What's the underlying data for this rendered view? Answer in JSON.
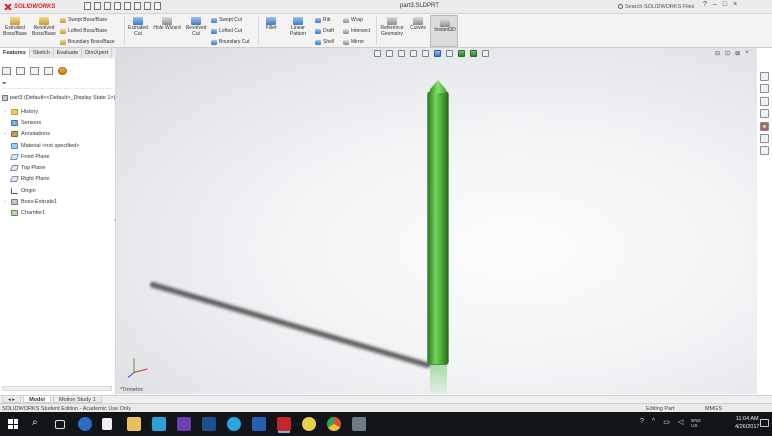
{
  "app": {
    "brand": "SOLIDWORKS",
    "document_title": "part3.SLDPRT",
    "search_placeholder": "Search SOLIDWORKS Files",
    "title_buttons": [
      "?",
      "–",
      "□",
      "×"
    ]
  },
  "command_manager": {
    "extruded_boss": "Extruded Boss/Base",
    "revolved_boss": "Revolved Boss/Base",
    "swept_boss": "Swept Boss/Base",
    "lofted_boss": "Lofted Boss/Base",
    "boundary_boss": "Boundary Boss/Base",
    "extruded_cut": "Extruded Cut",
    "hole_wizard": "Hole Wizard",
    "revolved_cut": "Revolved Cut",
    "swept_cut": "Swept Cut",
    "lofted_cut": "Lofted Cut",
    "boundary_cut": "Boundary Cut",
    "fillet": "Fillet",
    "linear_pattern": "Linear Pattern",
    "rib": "Rib",
    "draft": "Draft",
    "shell": "Shell",
    "wrap": "Wrap",
    "intersect": "Intersect",
    "mirror": "Mirror",
    "reference_geometry": "Reference Geometry",
    "curves": "Curves",
    "instant3d": "Instant3D"
  },
  "feature_manager": {
    "tabs": [
      "Features",
      "Sketch",
      "Evaluate",
      "DimXpert"
    ],
    "filter_icon": "funnel-icon",
    "root": "part3 (Default<<Default>_Display State 1>)",
    "items": [
      {
        "label": "History",
        "icon": "folder",
        "expandable": true
      },
      {
        "label": "Sensors",
        "icon": "sensor",
        "expandable": false
      },
      {
        "label": "Annotations",
        "icon": "annot",
        "expandable": true
      },
      {
        "label": "Material <not specified>",
        "icon": "material",
        "expandable": false
      },
      {
        "label": "Front Plane",
        "icon": "plane",
        "expandable": false
      },
      {
        "label": "Top Plane",
        "icon": "plane",
        "expandable": false
      },
      {
        "label": "Right Plane",
        "icon": "plane",
        "expandable": false
      },
      {
        "label": "Origin",
        "icon": "origin",
        "expandable": false
      },
      {
        "label": "Boss-Extrude1",
        "icon": "boss",
        "expandable": true
      },
      {
        "label": "Chamfer1",
        "icon": "chamfer",
        "expandable": false
      }
    ]
  },
  "viewport": {
    "view_label": "*Trimetric",
    "part_color": "#4fac3b",
    "window_controls": [
      "⊟",
      "⊡",
      "⊠",
      "×"
    ]
  },
  "model_tabs": [
    "Model",
    "Motion Study 1"
  ],
  "status_bar": {
    "left": "SOLIDWORKS Student Edition - Academic Use Only",
    "editing": "Editing Part",
    "units": "MMGS"
  },
  "taskbar": {
    "clock_time": "11:04 AM",
    "clock_date": "4/26/2017",
    "language": "ENG\nUS"
  }
}
